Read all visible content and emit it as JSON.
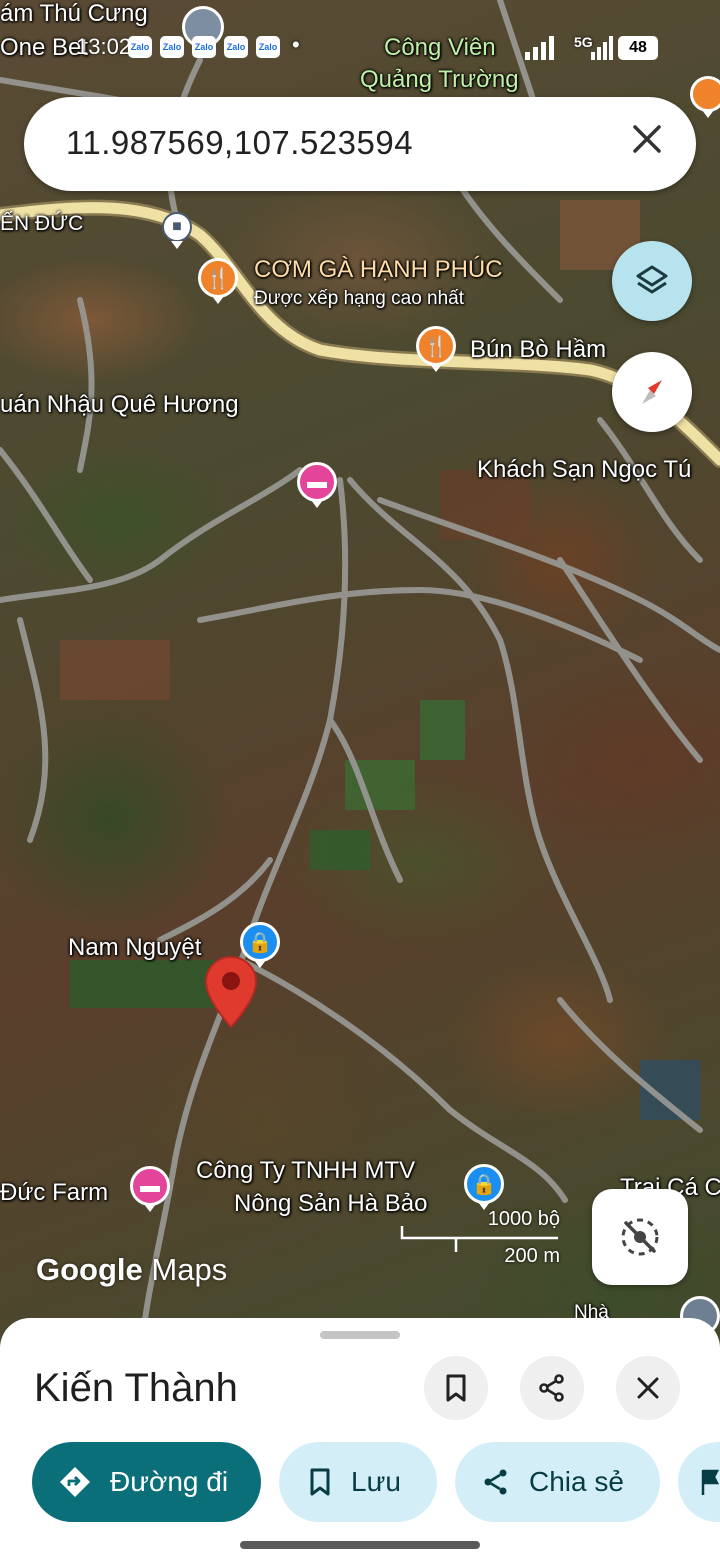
{
  "status_bar": {
    "time": "13:02",
    "network": "5G",
    "battery": "48",
    "notification_apps": [
      "Zalo",
      "Zalo",
      "Zalo",
      "Zalo",
      "Zalo"
    ]
  },
  "search": {
    "query": "11.987569,107.523594"
  },
  "map_labels": {
    "pet_shop": "ám Thú Cưng",
    "one_bet": "One Bet",
    "park_line1": "Công Viên",
    "park_line2": "Quảng Trường",
    "area": "ẾN ĐỨC",
    "restaurant_name": "CƠM GÀ HẠNH PHÚC",
    "restaurant_sub": "Được xếp hạng cao nhất",
    "bun_bo": "Bún Bò Hầm",
    "quan_nhau": "uán Nhậu Quê Hương",
    "khach_san": "Khách Sạn Ngọc Tú",
    "nam_nguyet": "Nam Nguyệt",
    "duc_farm": "Đức Farm",
    "company_line1": "Công Ty TNHH MTV",
    "company_line2": "Nông Sản Hà Bảo",
    "trai_ca": "Trại Cá C",
    "nha": "Nhà"
  },
  "scale": {
    "imperial": "1000 bộ",
    "metric": "200 m"
  },
  "branding": {
    "google": "Google",
    "maps": "Maps"
  },
  "place": {
    "title": "Kiến Thành"
  },
  "actions": {
    "directions": "Đường đi",
    "save": "Lưu",
    "share": "Chia sẻ"
  },
  "colors": {
    "primary_chip": "#0b6f79",
    "secondary_chip": "#d3eef6",
    "pin": "#e03a2e",
    "food_poi": "#f0822a",
    "hotel_poi": "#e4449a",
    "shop_poi": "#1a8ff0"
  }
}
